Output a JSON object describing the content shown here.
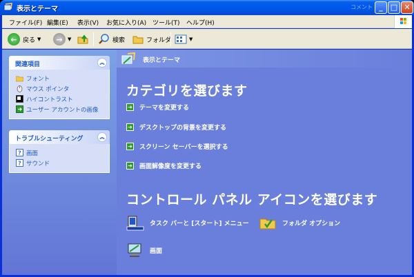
{
  "window": {
    "title": "表示とテーマ",
    "comment_label": "コメント"
  },
  "menu": {
    "items": [
      "ファイル(F)",
      "編集(E)",
      "表示(V)",
      "お気に入り(A)",
      "ツール(T)",
      "ヘルプ(H)"
    ]
  },
  "toolbar": {
    "back_label": "戻る",
    "search_label": "検索",
    "folders_label": "フォルダ"
  },
  "sidebar": {
    "related": {
      "title": "関連項目",
      "items": [
        "フォント",
        "マウス ポインタ",
        "ハイコントラスト",
        "ユーザー アカウントの画像"
      ]
    },
    "troubleshoot": {
      "title": "トラブルシューティング",
      "items": [
        "画面",
        "サウンド"
      ]
    }
  },
  "main": {
    "header_title": "表示とテーマ",
    "pick_task_heading": "カテゴリを選びます",
    "tasks": [
      "テーマを変更する",
      "デスクトップの背景を変更する",
      "スクリーン セーバーを選択する",
      "画面解像度を変更する"
    ],
    "pick_icon_heading": "コントロール パネル アイコンを選びます",
    "icons": [
      "タスク バーと [スタート] メニュー",
      "フォルダ オプション",
      "画面"
    ]
  },
  "colors": {
    "titlebar": "#0054e3",
    "menubar": "#ece9d8",
    "sidebar_link": "#215dc6",
    "main_bg": "#6a7fdb"
  }
}
